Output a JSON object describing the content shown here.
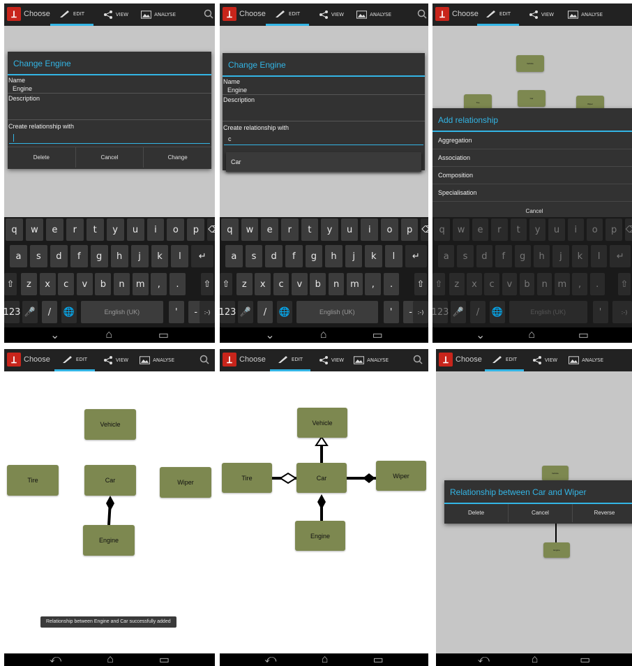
{
  "actionbar": {
    "choose": "Choose",
    "tab_edit": "EDIT",
    "tab_view": "VIEW",
    "tab_analyse": "ANALYSE"
  },
  "change_engine": {
    "title": "Change Engine",
    "name_label": "Name",
    "name_value": "Engine",
    "description_label": "Description",
    "create_label": "Create relationship with",
    "buttons": [
      "Delete",
      "Cancel",
      "Change"
    ],
    "typed_value": "c",
    "suggestion": "Car"
  },
  "keyboard": {
    "row1": [
      "q",
      "w",
      "e",
      "r",
      "t",
      "y",
      "u",
      "i",
      "o",
      "p"
    ],
    "row2": [
      "a",
      "s",
      "d",
      "f",
      "g",
      "h",
      "j",
      "k",
      "l"
    ],
    "row3": [
      "z",
      "x",
      "c",
      "v",
      "b",
      "n",
      "m",
      ",",
      "."
    ],
    "mode_key": "123",
    "space_label": "English (UK)",
    "slash": "/",
    "apostrophe": "'",
    "dash": "-",
    "smiley": ":-)"
  },
  "add_relationship": {
    "title": "Add relationship",
    "options": [
      "Aggregation",
      "Association",
      "Composition",
      "Specialisation"
    ],
    "cancel": "Cancel"
  },
  "nodes": {
    "vehicle": "Vehicle",
    "car": "Car",
    "tire": "Tire",
    "wiper": "Wiper",
    "engine": "Engine"
  },
  "toast": "Relationship between Engine and Car successfully added",
  "relationship_dialog": {
    "title": "Relationship between Car and Wiper",
    "buttons": [
      "Delete",
      "Cancel",
      "Reverse"
    ]
  },
  "colors": {
    "accent": "#33b5e5",
    "node": "#7d8850",
    "dialog": "#323232"
  }
}
